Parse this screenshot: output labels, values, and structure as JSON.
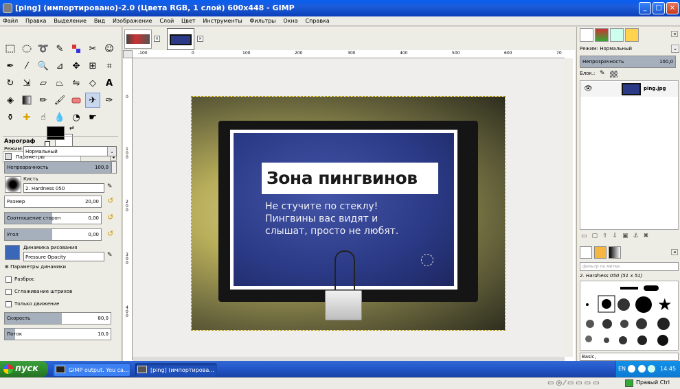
{
  "window": {
    "title": "[ping] (импортировано)-2.0 (Цвета RGB, 1 слой) 600x448 - GIMP"
  },
  "menu": [
    "Файл",
    "Правка",
    "Выделение",
    "Вид",
    "Изображение",
    "Слой",
    "Цвет",
    "Инструменты",
    "Фильтры",
    "Окна",
    "Справка"
  ],
  "tool_options": {
    "tab_label": "Параметры инструментов",
    "tool_name": "Аэрограф",
    "mode_label": "Режим:",
    "mode_value": "Нормальный",
    "opacity_label": "Непрозрачность",
    "opacity_value": "100,0",
    "brush_label": "Кисть",
    "brush_value": "2. Hardness 050",
    "size_label": "Размер",
    "size_value": "20,00",
    "aspect_label": "Соотношение сторон",
    "aspect_value": "0,00",
    "angle_label": "Угол",
    "angle_value": "0,00",
    "dynamics_label": "Динамика рисования",
    "dynamics_value": "Pressure Opacity",
    "dynamics_params": "Параметры динамики",
    "scatter": "Разброс",
    "smooth": "Сглаживание штрихов",
    "incremental": "Только движение",
    "rate_label": "Скорость",
    "rate_value": "80,0",
    "flow_label": "Поток",
    "flow_value": "10,0"
  },
  "ruler": {
    "h_ticks": [
      "-100",
      "0",
      "100",
      "200",
      "300",
      "400",
      "500",
      "600",
      "70"
    ],
    "v_ticks": [
      "0",
      "1\n0\n0",
      "2\n0\n0",
      "3\n0\n0",
      "4\n0\n0"
    ]
  },
  "photo": {
    "title": "Зона пингвинов",
    "line1": "Не стучите по стеклу!",
    "line2": "Пингвины вас видят и",
    "line3": "слышат, просто не любят."
  },
  "layers": {
    "mode_label": "Режим:",
    "mode_value": "Нормальный",
    "opacity_label": "Непрозрачность",
    "opacity_value": "100,0",
    "lock_label": "Блок.:",
    "layer_name": "ping.jpg"
  },
  "brushes": {
    "filter_placeholder": "фильтр по метке",
    "brush_name": "2. Hardness 050 (51 x 51)",
    "preset": "Basic,"
  },
  "taskbar": {
    "start": "пуск",
    "task1": "GIMP output. You ca...",
    "task2": "[ping] (импортирова...",
    "lang": "EN",
    "clock": "14:45"
  },
  "vm_status": {
    "host_key": "Правый Ctrl"
  },
  "colors": {
    "title_blue": "#0b3fb8",
    "taskbar_blue": "#2457c9",
    "start_green": "#2d8a2d"
  }
}
